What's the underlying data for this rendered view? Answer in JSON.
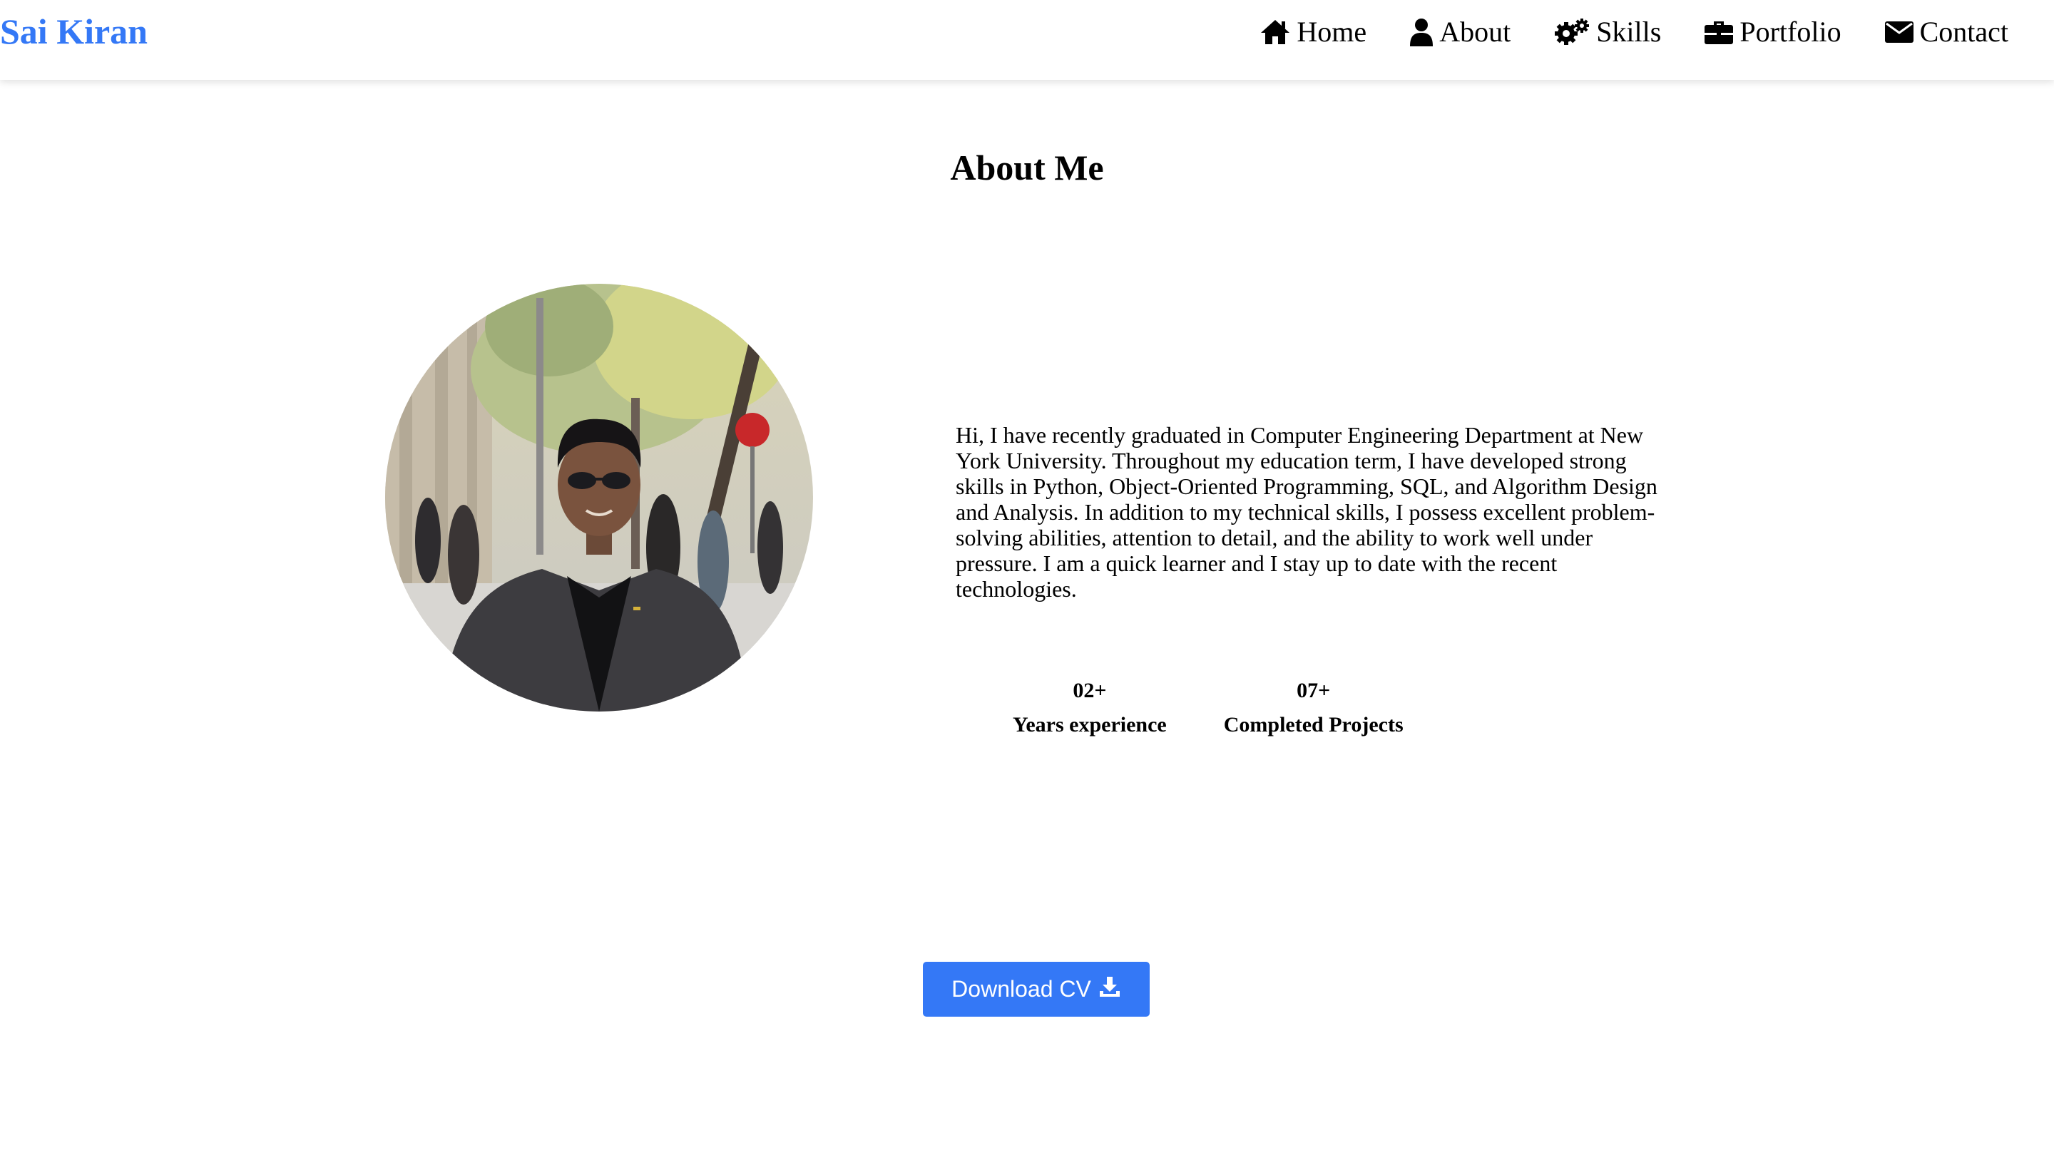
{
  "header": {
    "logo": "Sai Kiran",
    "nav": [
      {
        "label": "Home",
        "icon": "home-icon"
      },
      {
        "label": "About",
        "icon": "user-icon"
      },
      {
        "label": "Skills",
        "icon": "gears-icon"
      },
      {
        "label": "Portfolio",
        "icon": "briefcase-icon"
      },
      {
        "label": "Contact",
        "icon": "envelope-icon"
      }
    ]
  },
  "about": {
    "title": "About Me",
    "bio": "Hi, I have recently graduated in Computer Engineering Department at New York University. Throughout my education term, I have developed strong skills in Python, Object-Oriented Programming, SQL, and Algorithm Design and Analysis. In addition to my technical skills, I possess excellent problem-solving abilities, attention to detail, and the ability to work well under pressure. I am a quick learner and I stay up to date with the recent technologies.",
    "stats": [
      {
        "value": "02+",
        "label": "Years experience"
      },
      {
        "value": "07+",
        "label": "Completed Projects"
      }
    ],
    "download_label": "Download CV",
    "download_icon": "download-icon"
  },
  "colors": {
    "accent": "#3478f6",
    "text": "#000000",
    "background": "#ffffff"
  }
}
